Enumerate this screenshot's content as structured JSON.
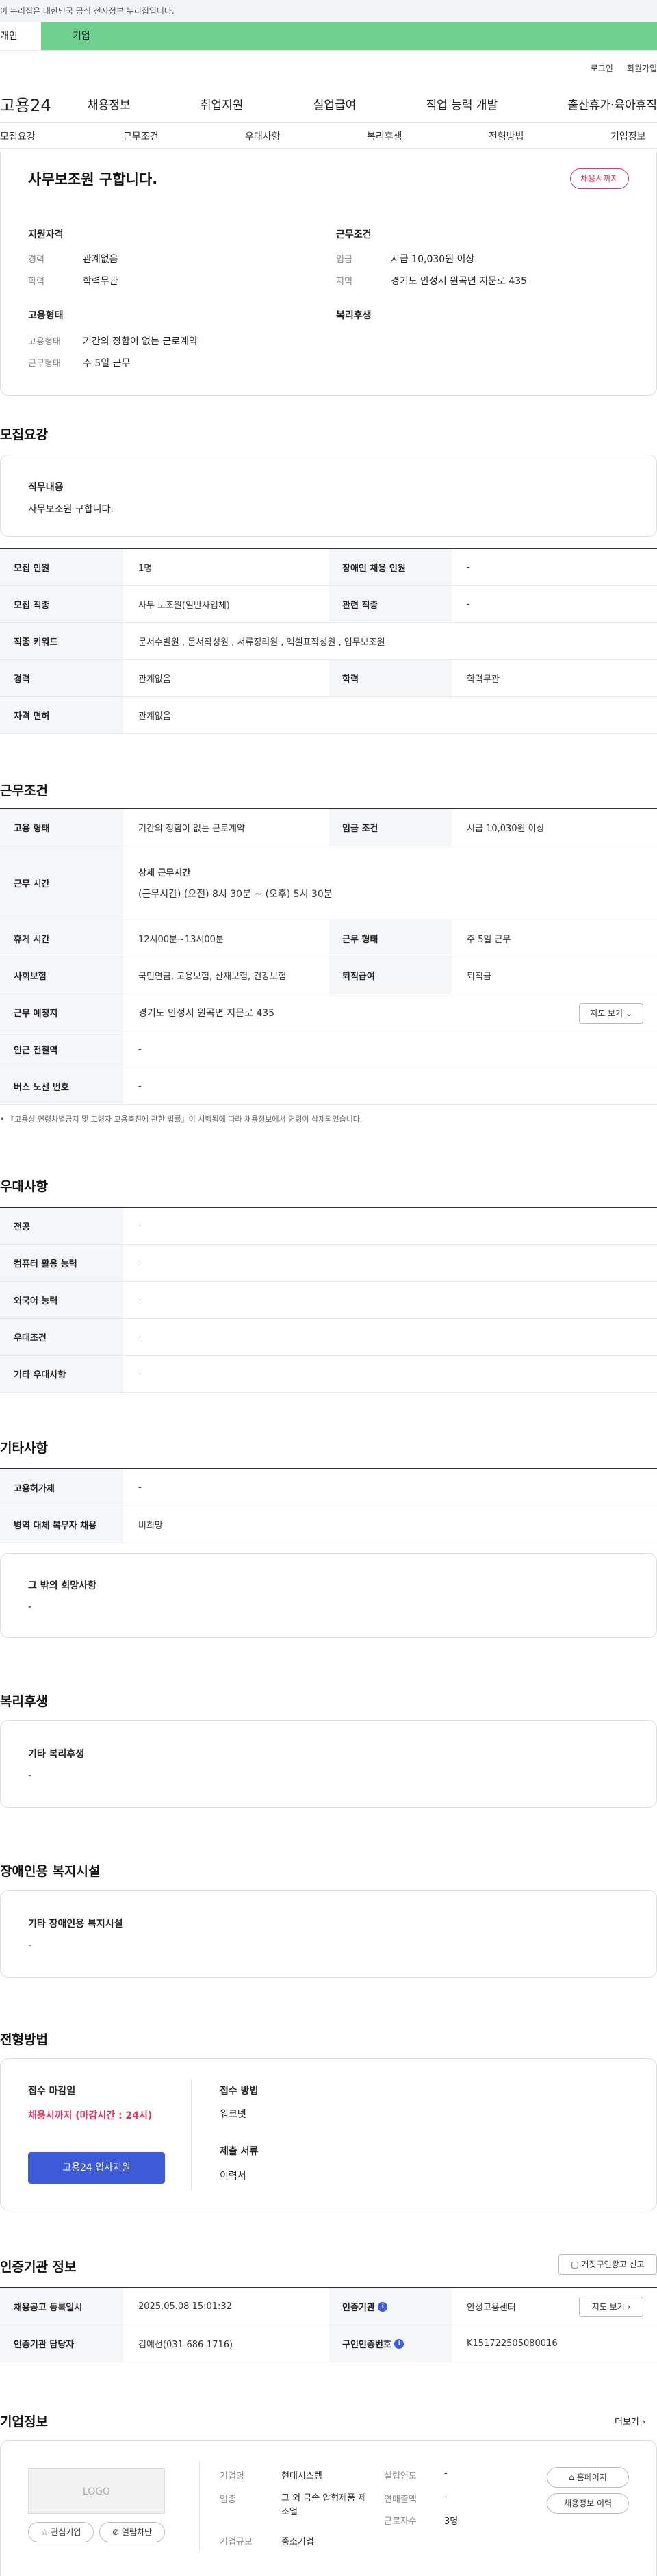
{
  "notice": "이 누리집은 대한민국 공식 전자정부 누리집입니다.",
  "tabs": [
    "개인",
    "기업"
  ],
  "util": [
    "로그인",
    "회원가입"
  ],
  "gnb": {
    "logo": "고용24",
    "menu": [
      "채용정보",
      "취업지원",
      "실업급여",
      "직업 능력 개발",
      "출산휴가·육아휴직"
    ]
  },
  "lnb": [
    "모집요강",
    "근무조건",
    "우대사항",
    "복리후생",
    "전형방법",
    "기업정보"
  ],
  "summary": {
    "title": "사무보조원 구합니다.",
    "badge": "채용시까지",
    "qual_head": "지원자격",
    "cond_head": "근무조건",
    "type_head": "고용형태",
    "welfare_head": "복리후생",
    "career_lbl": "경력",
    "career": "관계없음",
    "edu_lbl": "학력",
    "edu": "학력무관",
    "wage_lbl": "임금",
    "wage": "시급 10,030원 이상",
    "region_lbl": "지역",
    "region": "경기도 안성시 원곡면 지문로 435",
    "emp_lbl": "고용형태",
    "emp": "기간의 정함이 없는 근로계약",
    "work_lbl": "근무형태",
    "work": "주 5일 근무"
  },
  "recruit": {
    "heading": "모집요강",
    "duty_lbl": "직무내용",
    "duty": "사무보조원 구합니다.",
    "rows": [
      [
        "모집 인원",
        "1명",
        "장애인 채용 인원",
        "-"
      ],
      [
        "모집 직종",
        "사무 보조원(일반사업체)",
        "관련 직종",
        "-"
      ]
    ],
    "kw_lbl": "직종 키워드",
    "kw": "문서수발원 , 문서작성원 , 서류정리원 , 엑셀표작성원 , 업무보조원",
    "career_lbl": "경력",
    "career": "관계없음",
    "edu_lbl": "학력",
    "edu": "학력무관",
    "lic_lbl": "자격 면허",
    "lic": "관계없음"
  },
  "cond": {
    "heading": "근무조건",
    "emp_lbl": "고용 형태",
    "emp": "기간의 정함이 없는 근로계약",
    "wage_lbl": "임금 조건",
    "wage": "시급 10,030원 이상",
    "time_lbl": "근무 시간",
    "time_head": "상세 근무시간",
    "time": "(근무시간) (오전) 8시 30분 ~ (오후) 5시 30분",
    "rest_lbl": "휴게 시간",
    "rest": "12시00분~13시00분",
    "form_lbl": "근무 형태",
    "form": "주 5일 근무",
    "ins_lbl": "사회보험",
    "ins": "국민연금, 고용보험, 산재보험, 건강보험",
    "sev_lbl": "퇴직급여",
    "sev": "퇴직금",
    "place_lbl": "근무 예정지",
    "place": "경기도 안성시 원곡면 지문로 435",
    "map": "지도 보기",
    "sub_lbl": "인근 전철역",
    "sub": "-",
    "bus_lbl": "버스 노선 번호",
    "bus": "-",
    "note": "『고용상 연령차별금지 및 고령자 고용촉진에 관한 법률』이 시행됨에 따라 채용정보에서 연령이 삭제되었습니다."
  },
  "pref": {
    "heading": "우대사항",
    "rows": [
      [
        "전공",
        "-"
      ],
      [
        "컴퓨터 활용 능력",
        "-"
      ],
      [
        "외국어 능력",
        "-"
      ],
      [
        "우대조건",
        "-"
      ],
      [
        "기타 우대사항",
        "-"
      ]
    ]
  },
  "etc": {
    "heading": "기타사항",
    "rows": [
      [
        "고용허가제",
        "-"
      ],
      [
        "병역 대체 복무자 채용",
        "비희망"
      ]
    ],
    "wish_lbl": "그 밖의 희망사항",
    "wish": "-"
  },
  "welfare": {
    "heading": "복리후생",
    "lbl": "기타 복리후생",
    "val": "-"
  },
  "facility": {
    "heading": "장애인용 복지시설",
    "lbl": "기타 장애인용 복지시설",
    "val": "-"
  },
  "process": {
    "heading": "전형방법",
    "deadline_lbl": "접수 마감일",
    "deadline": "채용시까지 (마감시간 : 24시)",
    "apply": "고용24 입사지원",
    "method_lbl": "접수 방법",
    "method": "워크넷",
    "docs_lbl": "제출 서류",
    "docs": "이력서"
  },
  "agency": {
    "heading": "인증기관 정보",
    "report": "거짓구인광고 신고",
    "reg_lbl": "채용공고 등록일시",
    "reg": "2025.05.08 15:01:32",
    "org_lbl": "인증기관",
    "org": "안성고용센터",
    "map": "지도 보기",
    "mgr_lbl": "인증기관 담당자",
    "mgr": "김예선(031-686-1716)",
    "no_lbl": "구인인증번호",
    "no": "K151722505080016"
  },
  "company": {
    "heading": "기업정보",
    "more": "더보기",
    "logo": "LOGO",
    "fav": "관심기업",
    "block": "열람차단",
    "name_lbl": "기업명",
    "name": "현대시스템",
    "ind_lbl": "업종",
    "ind": "그 외 금속 압형제품 제조업",
    "size_lbl": "기업규모",
    "size": "중소기업",
    "year_lbl": "설립연도",
    "year": "-",
    "sales_lbl": "연매출액",
    "sales": "-",
    "emp_lbl": "근로자수",
    "emp": "3명",
    "home": "홈페이지",
    "jobs": "채용정보 이력"
  }
}
